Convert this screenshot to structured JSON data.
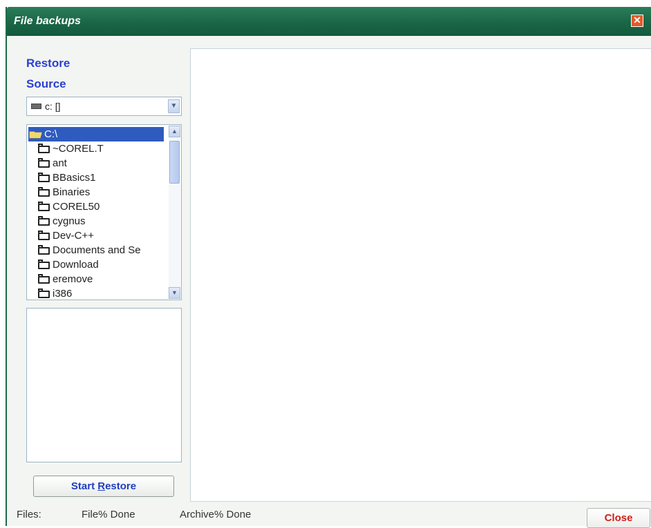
{
  "window": {
    "title": "File backups",
    "close_glyph": "✕"
  },
  "sidebar": {
    "heading1": "Restore",
    "heading2": "Source",
    "drive_select": {
      "value": "c: []",
      "icon": "drive-icon"
    },
    "tree": {
      "root": "C:\\",
      "items": [
        "~COREL.T",
        "ant",
        "BBasics1",
        "Binaries",
        "COREL50",
        "cygnus",
        "Dev-C++",
        "Documents and Se",
        "Download",
        "eremove",
        "i386"
      ]
    },
    "start_button": {
      "prefix": "Start ",
      "mnemonic": "R",
      "suffix": "estore"
    }
  },
  "status_bar": {
    "files_label": "Files:",
    "file_pct_label": "File% Done",
    "archive_pct_label": "Archive% Done",
    "close_label": "Close"
  },
  "colors": {
    "title_bar": "#1a6646",
    "accent_text": "#2a3fd3",
    "close_text": "#d0201a",
    "selection": "#2f5bbf"
  }
}
